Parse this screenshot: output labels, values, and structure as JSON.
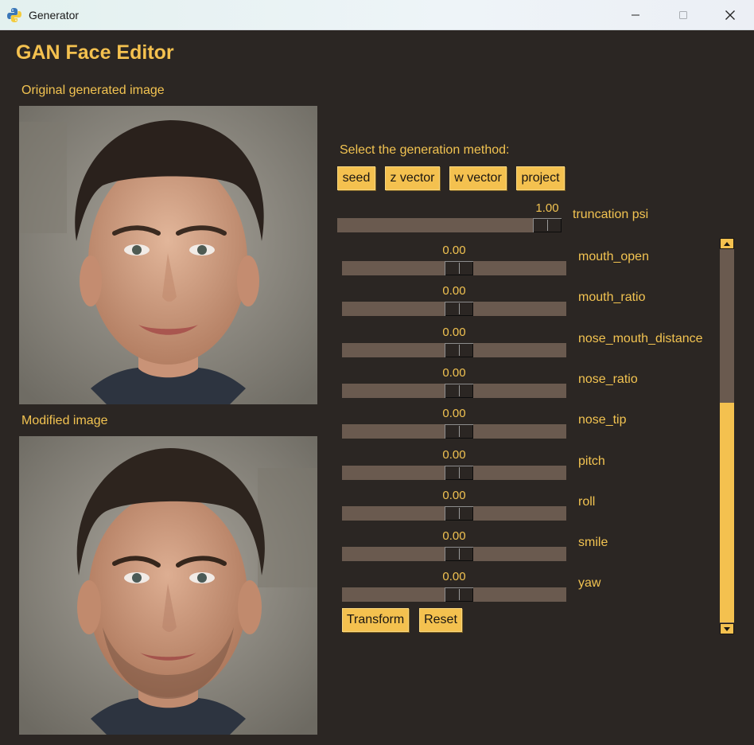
{
  "window": {
    "title": "Generator",
    "icon": "python-icon",
    "controls": [
      "minimize-icon",
      "maximize-icon",
      "close-icon"
    ]
  },
  "app": {
    "heading": "GAN Face Editor",
    "original_label": "Original generated image",
    "modified_label": "Modified image"
  },
  "generation": {
    "prompt": "Select the generation method:",
    "buttons": [
      "seed",
      "z vector",
      "w vector",
      "project"
    ]
  },
  "truncation": {
    "label": "truncation psi",
    "value": "1.00",
    "position": 1.0
  },
  "attributes": [
    {
      "name": "mouth_open",
      "value": "0.00",
      "position": 0.5
    },
    {
      "name": "mouth_ratio",
      "value": "0.00",
      "position": 0.5
    },
    {
      "name": "nose_mouth_distance",
      "value": "0.00",
      "position": 0.5
    },
    {
      "name": "nose_ratio",
      "value": "0.00",
      "position": 0.5
    },
    {
      "name": "nose_tip",
      "value": "0.00",
      "position": 0.5
    },
    {
      "name": "pitch",
      "value": "0.00",
      "position": 0.5
    },
    {
      "name": "roll",
      "value": "0.00",
      "position": 0.5
    },
    {
      "name": "smile",
      "value": "0.00",
      "position": 0.5
    },
    {
      "name": "yaw",
      "value": "0.00",
      "position": 0.5
    }
  ],
  "actions": {
    "transform_label": "Transform",
    "reset_label": "Reset"
  },
  "colors": {
    "background": "#2b2623",
    "accent": "#f4c14f",
    "track": "#6a5a4f"
  }
}
